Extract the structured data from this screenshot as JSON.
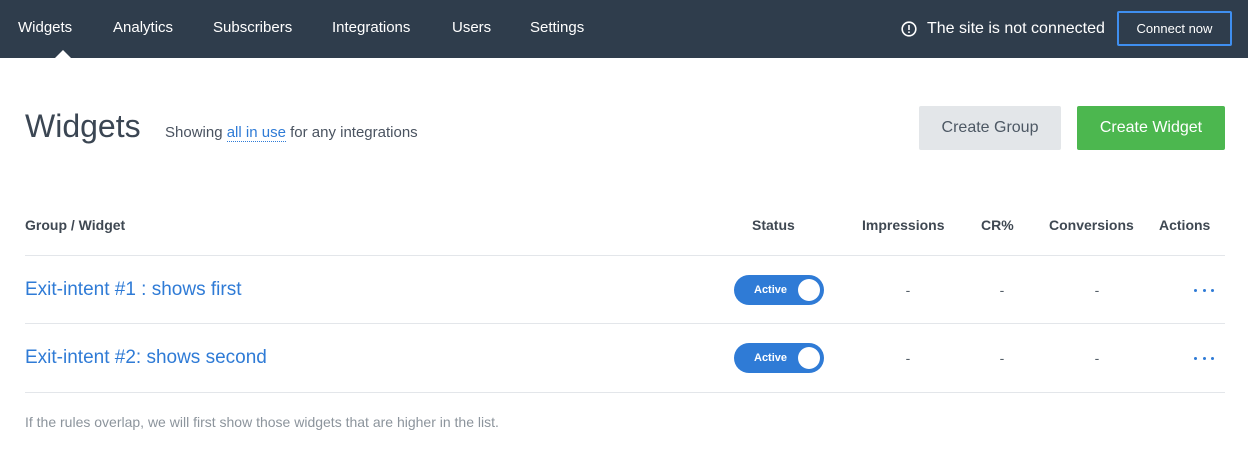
{
  "nav": {
    "items": [
      {
        "label": "Widgets",
        "active": true
      },
      {
        "label": "Analytics"
      },
      {
        "label": "Subscribers"
      },
      {
        "label": "Integrations"
      },
      {
        "label": "Users"
      },
      {
        "label": "Settings"
      }
    ],
    "status_text": "The site is not connected",
    "connect_label": "Connect now"
  },
  "header": {
    "title": "Widgets",
    "showing_prefix": "Showing",
    "showing_filter": "all in use",
    "showing_suffix": "for any integrations",
    "create_group_label": "Create Group",
    "create_widget_label": "Create Widget"
  },
  "table": {
    "columns": [
      "Group / Widget",
      "Status",
      "Impressions",
      "CR%",
      "Conversions",
      "Actions"
    ],
    "rows": [
      {
        "name": "Exit-intent #1 : shows first",
        "status": "Active",
        "impressions": "-",
        "cr": "-",
        "conversions": "-"
      },
      {
        "name": "Exit-intent #2: shows second",
        "status": "Active",
        "impressions": "-",
        "cr": "-",
        "conversions": "-"
      }
    ],
    "footnote": "If the rules overlap, we will first show those widgets that are higher in the list."
  },
  "colors": {
    "topbar": "#2f3d4c",
    "link": "#2f7bd6",
    "primary": "#4cb74f",
    "connect_border": "#3f8ff0"
  }
}
